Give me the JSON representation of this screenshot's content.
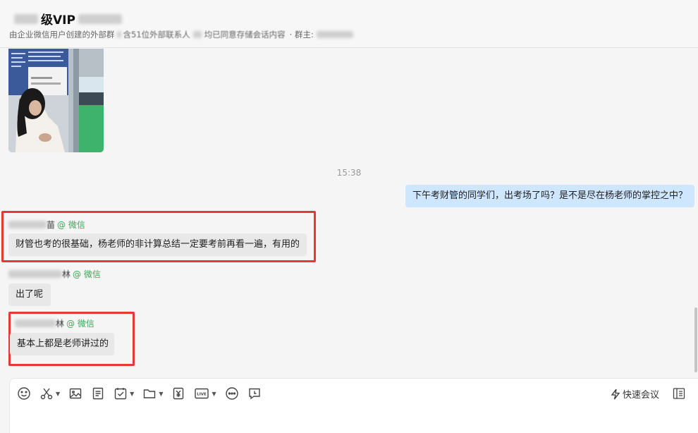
{
  "header": {
    "title": "级VIP",
    "title_suffix": "",
    "subtitle_lead": "由企业微信用户创建的外部群",
    "subtitle_mid": "含51位外部联系人",
    "subtitle_tail": "均已同意存储会话内容",
    "subtitle_owner": "· 群主:"
  },
  "messages": {
    "timestamp": "15:38",
    "outgoing_1": "下午考财管的同学们，出考场了吗？是不是尽在杨老师的掌控之中？",
    "msg_1": {
      "name_tail": "苗",
      "source": "@ 微信",
      "text": "财管也考的很基础，杨老师的非计算总结一定要考前再看一遍，有用的"
    },
    "msg_2": {
      "name_tail": "林",
      "source": "@ 微信",
      "text": "出了呢"
    },
    "msg_3": {
      "name_tail": "林",
      "source": "@ 微信",
      "text": "基本上都是老师讲过的"
    }
  },
  "composer": {
    "quick_meeting_label": "快速会议"
  },
  "icons": [
    "emoji-icon",
    "scissors-icon",
    "image-icon",
    "document-icon",
    "todo-icon",
    "folder-icon",
    "money-icon",
    "live-icon",
    "more-icon",
    "schedule-icon",
    "lightning-icon",
    "sidebar-toggle-icon"
  ],
  "colors": {
    "outgoing_bubble": "#cfe6ff",
    "incoming_bubble": "#e8e8e8",
    "highlight": "#e53935",
    "source_green": "#3aa757"
  }
}
